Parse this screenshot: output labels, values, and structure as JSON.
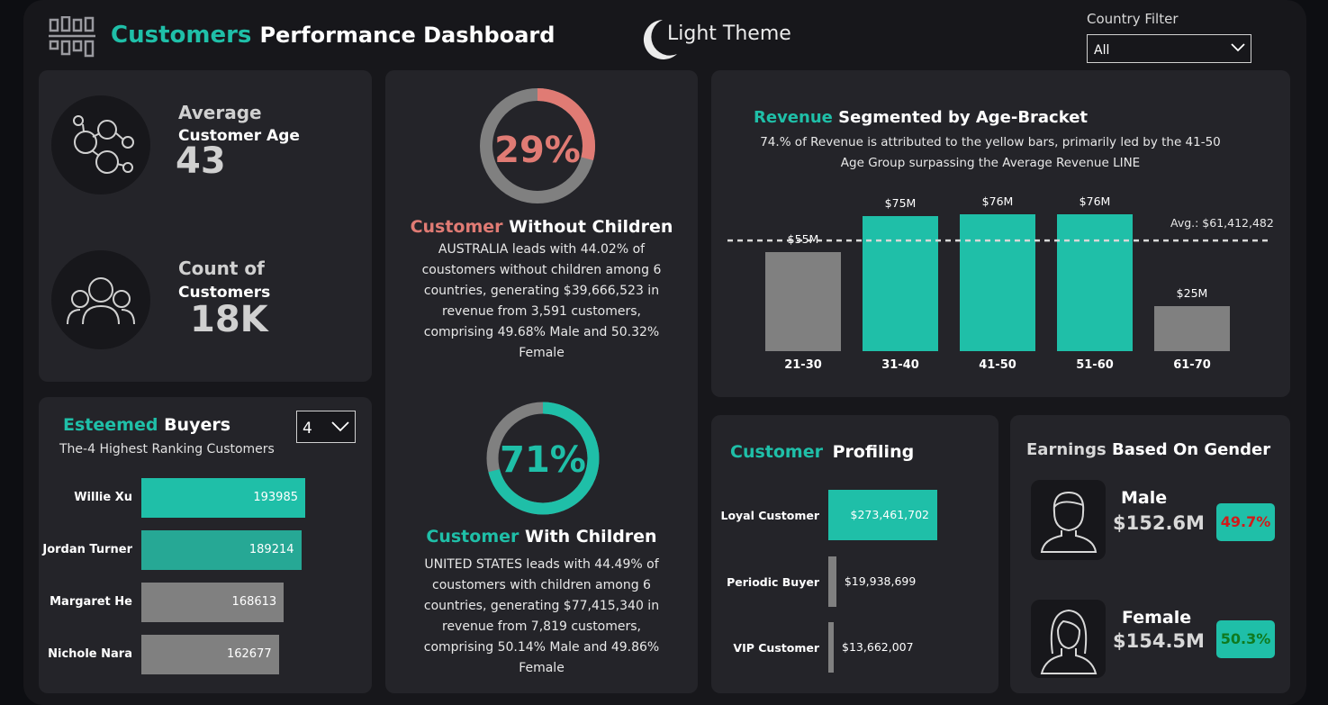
{
  "colors": {
    "teal": "#1fbfa8",
    "salmon": "#e07b74",
    "gray": "#808080",
    "panel": "#242429"
  },
  "header": {
    "title_accent": "Customers",
    "title_rest": "Performance Dashboard",
    "theme_label": "Light Theme",
    "country_filter_label": "Country Filter",
    "country_filter_value": "All"
  },
  "kpis": {
    "avg_age": {
      "title": "Average",
      "subtitle": "Customer Age",
      "value": "43"
    },
    "count": {
      "title": "Count of",
      "subtitle": "Customers",
      "value": "18K"
    }
  },
  "buyers": {
    "title_accent": "Esteemed",
    "title_rest": "Buyers",
    "subtitle": "The-4 Highest Ranking Customers",
    "topn": "4",
    "items": [
      {
        "name": "Willie Xu",
        "value": 193985,
        "label": "193985",
        "color": "#1fbfa8"
      },
      {
        "name": "Jordan Turner",
        "value": 189214,
        "label": "189214",
        "color": "#26a895"
      },
      {
        "name": "Margaret He",
        "value": 168613,
        "label": "168613",
        "color": "#808080"
      },
      {
        "name": "Nichole Nara",
        "value": 162677,
        "label": "162677",
        "color": "#808080"
      }
    ]
  },
  "children": {
    "without": {
      "percent": 29,
      "percent_label": "29%",
      "title_accent": "Customer",
      "title_rest": "Without Children",
      "text": "AUSTRALIA leads with 44.02% of coustomers without children among 6 countries, generating $39,666,523 in revenue from 3,591 customers, comprising 49.68% Male and 50.32% Female"
    },
    "with": {
      "percent": 71,
      "percent_label": "71%",
      "title_accent": "Customer",
      "title_rest": "With Children",
      "text": "UNITED STATES leads with 44.49% of coustomers with children among 6 countries, generating $77,415,340 in revenue from 7,819 customers, comprising 50.14% Male and 49.86% Female"
    }
  },
  "revenue": {
    "title_accent": "Revenue",
    "title_rest": "Segmented by Age-Bracket",
    "subtitle_line1": "74.% of Revenue is attributed to the yellow bars, primarily led by the 41-50",
    "subtitle_line2": "Age Group surpassing the Average Revenue LINE",
    "avg_label": "Avg.: $61,412,482",
    "chart_data": {
      "type": "bar",
      "categories": [
        "21-30",
        "31-40",
        "41-50",
        "51-60",
        "61-70"
      ],
      "values": [
        55,
        75,
        76,
        76,
        25
      ],
      "labels": [
        "$55M",
        "$75M",
        "$76M",
        "$76M",
        "$25M"
      ],
      "colors": [
        "#808080",
        "#1fbfa8",
        "#1fbfa8",
        "#1fbfa8",
        "#808080"
      ],
      "average": 61.41,
      "ylim": [
        0,
        80
      ],
      "unit": "$M"
    }
  },
  "profiling": {
    "title_accent": "Customer",
    "title_rest": "Profiling",
    "items": [
      {
        "name": "Loyal Customer",
        "value": 273461702,
        "label": "$273,461,702",
        "color": "#1fbfa8"
      },
      {
        "name": "Periodic Buyer",
        "value": 19938699,
        "label": "$19,938,699",
        "color": "#808080"
      },
      {
        "name": "VIP Customer",
        "value": 13662007,
        "label": "$13,662,007",
        "color": "#808080"
      }
    ]
  },
  "gender": {
    "title_accent": "Earnings",
    "title_rest": "Based On Gender",
    "male": {
      "label": "Male",
      "value": "$152.6M",
      "pct": "49.7%"
    },
    "female": {
      "label": "Female",
      "value": "$154.5M",
      "pct": "50.3%"
    }
  }
}
